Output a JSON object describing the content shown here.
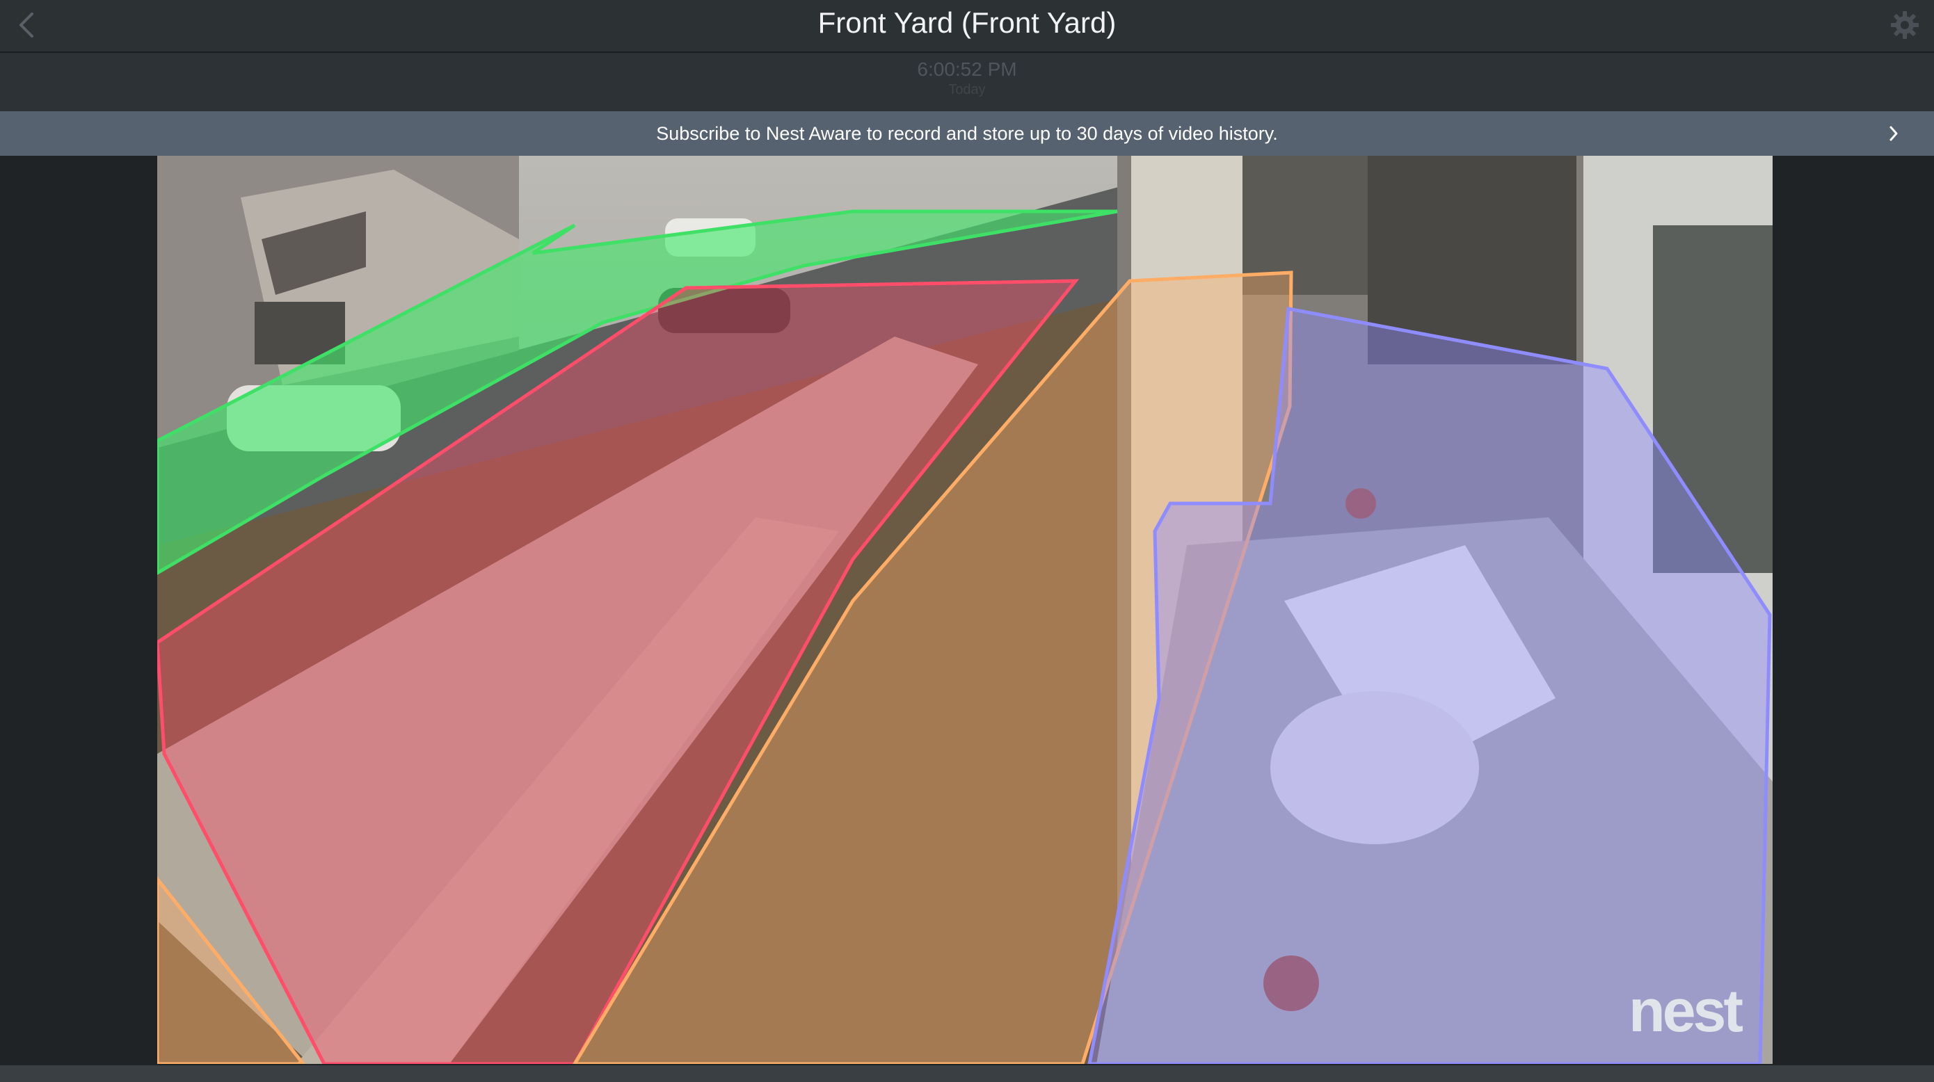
{
  "header": {
    "title": "Front Yard (Front Yard)",
    "back_icon": "chevron-left-icon",
    "settings_icon": "gear-icon"
  },
  "timeline": {
    "time": "6:00:52 PM",
    "date": "Today"
  },
  "banner": {
    "text": "Subscribe to Nest Aware to record and store up to 30 days of video history.",
    "chevron_icon": "chevron-right-icon"
  },
  "video": {
    "watermark": "nest"
  },
  "zones": [
    {
      "name": "green-zone",
      "color": "#43e86c"
    },
    {
      "name": "red-zone",
      "color": "#ff4d6a"
    },
    {
      "name": "orange-zone",
      "color": "#ffad66"
    },
    {
      "name": "purple-zone",
      "color": "#8f8cff"
    }
  ]
}
